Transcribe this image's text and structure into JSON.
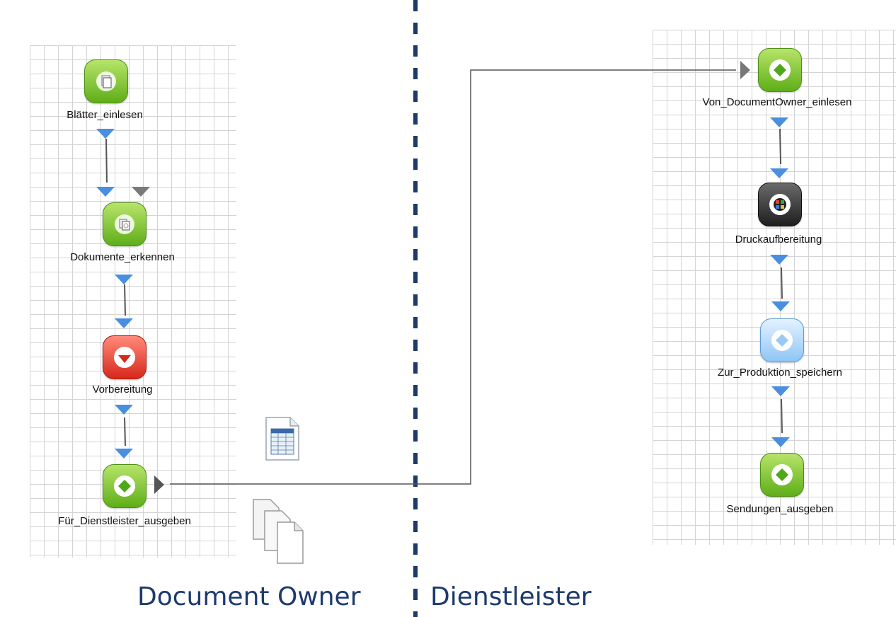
{
  "lanes": {
    "left_label": "Document Owner",
    "right_label": "Dienstleister"
  },
  "left_workflow": {
    "steps": [
      {
        "label": "Blätter_einlesen",
        "icon": "scan-pages-icon",
        "color": "green"
      },
      {
        "label": "Dokumente_erkennen",
        "icon": "recognize-documents-icon",
        "color": "green"
      },
      {
        "label": "Vorbereitung",
        "icon": "diamond-icon",
        "color": "red"
      },
      {
        "label": "Für_Dienstleister_ausgeben",
        "icon": "diamond-icon",
        "color": "green"
      }
    ]
  },
  "right_workflow": {
    "steps": [
      {
        "label": "Von_DocumentOwner_einlesen",
        "icon": "diamond-icon",
        "color": "green"
      },
      {
        "label": "Druckaufbereitung",
        "icon": "print-prep-icon",
        "color": "dark"
      },
      {
        "label": "Zur_Produktion_speichern",
        "icon": "diamond-icon",
        "color": "blue"
      },
      {
        "label": "Sendungen_ausgeben",
        "icon": "diamond-icon",
        "color": "green"
      }
    ]
  },
  "decorations": {
    "spreadsheet_icon": "spreadsheet-document-icon",
    "documents_stack_icon": "document-stack-icon"
  },
  "colors": {
    "lane_text": "#1d3a6e",
    "divider": "#1d3a6e",
    "arrow_port": "#4a8ee0",
    "connector": "#555555"
  }
}
